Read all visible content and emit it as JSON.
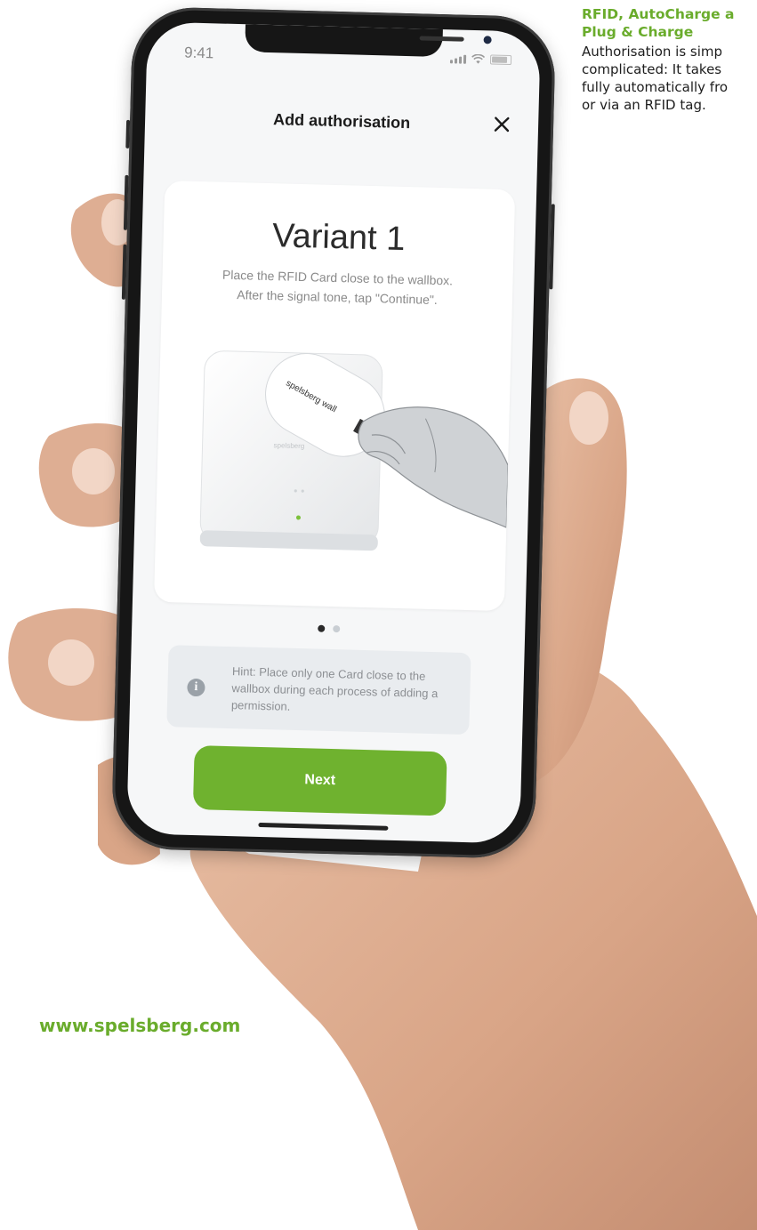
{
  "aside": {
    "title": "RFID, AutoCharge a\nPlug & Charge",
    "body": "Authorisation is simp\ncomplicated: It takes\nfully automatically fro\nor via an RFID tag."
  },
  "footer": {
    "url": "www.spelsberg.com"
  },
  "status_bar": {
    "time": "9:41",
    "icons": [
      "signal-icon",
      "wifi-icon",
      "battery-icon"
    ]
  },
  "header": {
    "title": "Add authorisation",
    "close_icon": "close-icon"
  },
  "card": {
    "title": "Variant 1",
    "description": "Place the RFID Card close to the wallbox.\nAfter the signal tone, tap \"Continue\".",
    "illustration": {
      "wallbox_logo": "spelsberg",
      "card_text": "spelsberg wall"
    }
  },
  "pager": {
    "pages": 2,
    "active": 1
  },
  "hint": {
    "icon": "info-icon",
    "text": "Hint: Place only one Card close to the\nwallbox during each process of adding a\npermission."
  },
  "next_button": {
    "label": "Next"
  },
  "colors": {
    "brand_green": "#6aac2c",
    "button_green": "#6fb22f",
    "screen_bg": "#f6f7f8"
  }
}
